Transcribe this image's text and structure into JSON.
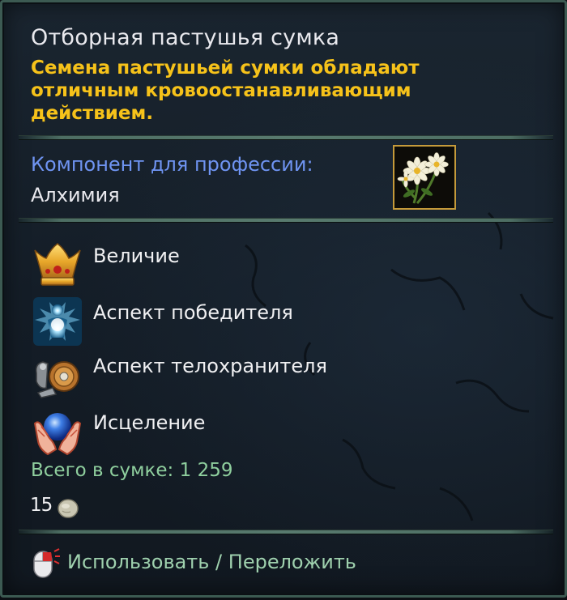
{
  "item": {
    "title": "Отборная пастушья сумка",
    "description": "Семена пастушьей сумки обладают отличным кровоостанавливающим действием.",
    "icon": "white-flower-icon"
  },
  "profession": {
    "label": "Компонент для профессии:",
    "value": "Алхимия"
  },
  "buffs": [
    {
      "label": "Величие",
      "icon": "crown-icon"
    },
    {
      "label": "Аспект победителя",
      "icon": "glowing-figure-icon"
    },
    {
      "label": "Аспект телохранителя",
      "icon": "shield-arm-icon"
    },
    {
      "label": "Исцеление",
      "icon": "healing-hands-icon"
    }
  ],
  "inventory": {
    "total": "Всего в сумке: 1 259",
    "stack": "15",
    "currency_icon": "coin-icon"
  },
  "action": {
    "label": "Использовать / Переложить",
    "icon": "mouse-icon"
  },
  "colors": {
    "description": "#f6c21a",
    "profession_label": "#6f94f2",
    "total": "#8fcf9e",
    "action": "#9fd1ae",
    "border": "#3c5a52",
    "icon_frame": "#c59a3a"
  }
}
